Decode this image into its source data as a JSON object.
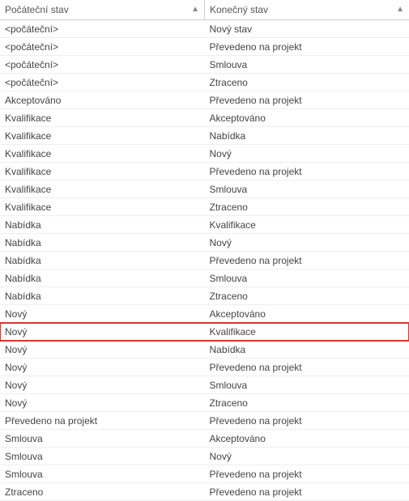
{
  "columns": [
    {
      "label": "Počáteční stav"
    },
    {
      "label": "Konečný stav"
    }
  ],
  "rows": [
    {
      "start": "<počáteční>",
      "end": "Nový stav",
      "highlight": false
    },
    {
      "start": "<počáteční>",
      "end": "Převedeno na projekt",
      "highlight": false
    },
    {
      "start": "<počáteční>",
      "end": "Smlouva",
      "highlight": false
    },
    {
      "start": "<počáteční>",
      "end": "Ztraceno",
      "highlight": false
    },
    {
      "start": "Akceptováno",
      "end": "Převedeno na projekt",
      "highlight": false
    },
    {
      "start": "Kvalifikace",
      "end": "Akceptováno",
      "highlight": false
    },
    {
      "start": "Kvalifikace",
      "end": "Nabídka",
      "highlight": false
    },
    {
      "start": "Kvalifikace",
      "end": "Nový",
      "highlight": false
    },
    {
      "start": "Kvalifikace",
      "end": "Převedeno na projekt",
      "highlight": false
    },
    {
      "start": "Kvalifikace",
      "end": "Smlouva",
      "highlight": false
    },
    {
      "start": "Kvalifikace",
      "end": "Ztraceno",
      "highlight": false
    },
    {
      "start": "Nabídka",
      "end": "Kvalifikace",
      "highlight": false
    },
    {
      "start": "Nabídka",
      "end": "Nový",
      "highlight": false
    },
    {
      "start": "Nabídka",
      "end": "Převedeno na projekt",
      "highlight": false
    },
    {
      "start": "Nabídka",
      "end": "Smlouva",
      "highlight": false
    },
    {
      "start": "Nabídka",
      "end": "Ztraceno",
      "highlight": false
    },
    {
      "start": "Nový",
      "end": "Akceptováno",
      "highlight": false
    },
    {
      "start": "Nový",
      "end": "Kvalifikace",
      "highlight": true
    },
    {
      "start": "Nový",
      "end": "Nabídka",
      "highlight": false
    },
    {
      "start": "Nový",
      "end": "Převedeno na projekt",
      "highlight": false
    },
    {
      "start": "Nový",
      "end": "Smlouva",
      "highlight": false
    },
    {
      "start": "Nový",
      "end": "Ztraceno",
      "highlight": false
    },
    {
      "start": "Převedeno na projekt",
      "end": "Převedeno na projekt",
      "highlight": false
    },
    {
      "start": "Smlouva",
      "end": "Akceptováno",
      "highlight": false
    },
    {
      "start": "Smlouva",
      "end": "Nový",
      "highlight": false
    },
    {
      "start": "Smlouva",
      "end": "Převedeno na projekt",
      "highlight": false
    },
    {
      "start": "Ztraceno",
      "end": "Převedeno na projekt",
      "highlight": false
    }
  ]
}
